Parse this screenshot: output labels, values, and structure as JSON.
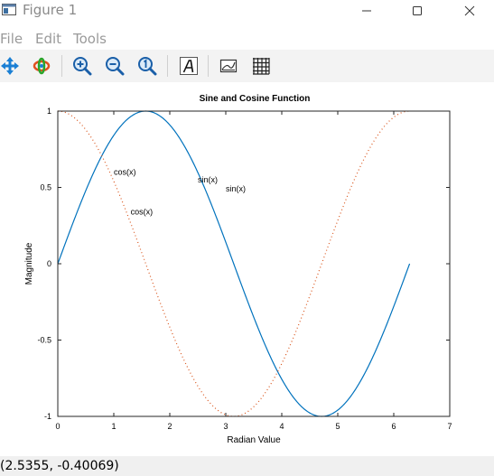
{
  "window": {
    "title": "Figure 1",
    "minimize_icon": "minimize-icon",
    "maximize_icon": "maximize-icon",
    "close_icon": "close-icon"
  },
  "menu": [
    {
      "label": "File"
    },
    {
      "label": "Edit"
    },
    {
      "label": "Tools"
    }
  ],
  "toolbar": [
    {
      "icon": "pan-icon"
    },
    {
      "icon": "rotate-icon"
    },
    {
      "icon": "zoom-in-icon"
    },
    {
      "icon": "zoom-out-icon"
    },
    {
      "icon": "reset-zoom-icon"
    },
    {
      "icon": "insert-text-icon"
    },
    {
      "icon": "toggle-axes-icon"
    },
    {
      "icon": "toggle-grid-icon"
    }
  ],
  "status": {
    "coordinates": "(2.5355, -0.40069)"
  },
  "chart_data": {
    "type": "line",
    "title": "Sine and Cosine Function",
    "xlabel": "Radian Value",
    "ylabel": "Magnitude",
    "xlim": [
      0,
      7
    ],
    "ylim": [
      -1,
      1
    ],
    "x_ticks": [
      "0",
      "1",
      "2",
      "3",
      "4",
      "5",
      "6",
      "7"
    ],
    "y_ticks": [
      "1",
      "0.5",
      "0",
      "-0.5",
      "-1"
    ],
    "series": [
      {
        "name": "sin(x)",
        "function": "sin",
        "x_range": [
          0,
          6.2832
        ],
        "style": "solid",
        "color": "#0072bd"
      },
      {
        "name": "cos(x)",
        "function": "cos",
        "x_range": [
          0,
          6.2832
        ],
        "style": "dotted",
        "color": "#d95319"
      }
    ],
    "annotations": [
      {
        "text": "cos(x)",
        "x": 1.0,
        "y": 0.6
      },
      {
        "text": "sin(x)",
        "x": 2.5,
        "y": 0.55
      },
      {
        "text": "sin(x)",
        "x": 3.0,
        "y": 0.49
      },
      {
        "text": "cos(x)",
        "x": 1.3,
        "y": 0.34
      }
    ]
  }
}
